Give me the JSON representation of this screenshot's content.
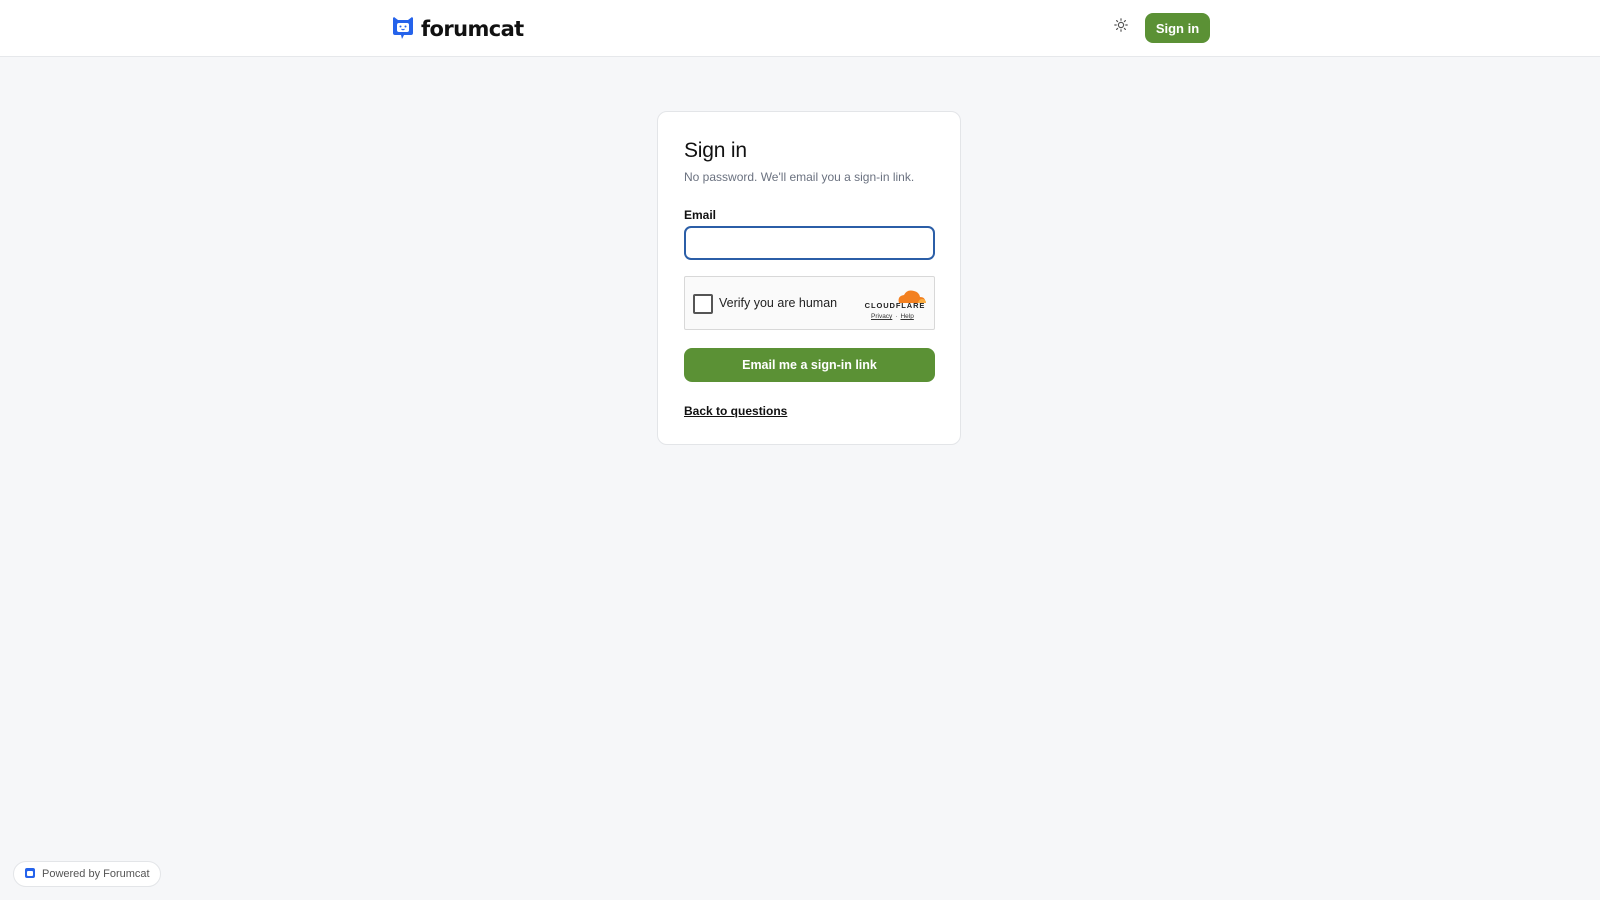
{
  "header": {
    "logo_text": "forumcat",
    "theme_icon": "sun-icon",
    "signin_label": "Sign in"
  },
  "signin_card": {
    "title": "Sign in",
    "subtitle": "No password. We'll email you a sign-in link.",
    "email_label": "Email",
    "email_value": "",
    "email_placeholder": "",
    "captcha": {
      "label": "Verify you are human",
      "brand": "CLOUDFLARE",
      "privacy_link": "Privacy",
      "separator": "·",
      "help_link": "Help"
    },
    "submit_label": "Email me a sign-in link",
    "back_link": "Back to questions"
  },
  "footer": {
    "powered_by": "Powered by Forumcat"
  },
  "colors": {
    "accent_green": "#5b9135",
    "brand_blue": "#2563eb",
    "focus_ring": "#2b5ea7",
    "cloudflare_orange": "#f38020",
    "background": "#f6f7f9"
  }
}
